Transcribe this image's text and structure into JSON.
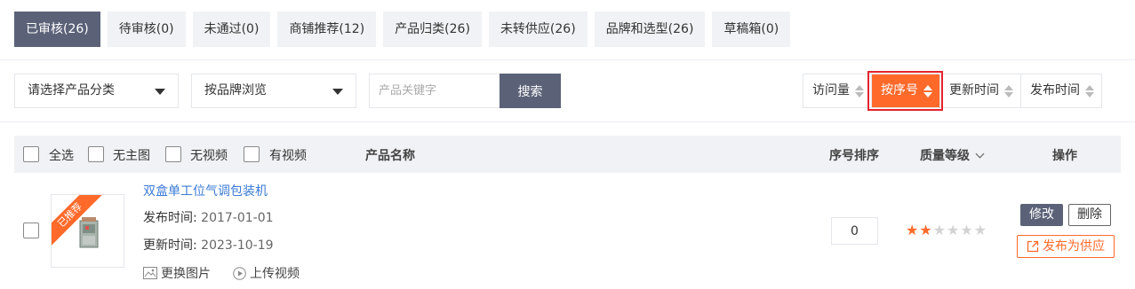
{
  "tabs": [
    {
      "label": "已审核(26)",
      "active": true
    },
    {
      "label": "待审核(0)",
      "active": false
    },
    {
      "label": "未通过(0)",
      "active": false
    },
    {
      "label": "商铺推荐(12)",
      "active": false
    },
    {
      "label": "产品归类(26)",
      "active": false
    },
    {
      "label": "未转供应(26)",
      "active": false
    },
    {
      "label": "品牌和选型(26)",
      "active": false
    },
    {
      "label": "草稿箱(0)",
      "active": false
    }
  ],
  "filters": {
    "category_select": "请选择产品分类",
    "brand_select": "按品牌浏览",
    "keyword_placeholder": "产品关键字",
    "search_label": "搜索"
  },
  "sorts": [
    {
      "label": "访问量",
      "active": false
    },
    {
      "label": "按序号",
      "active": true
    },
    {
      "label": "更新时间",
      "active": false
    },
    {
      "label": "发布时间",
      "active": false
    }
  ],
  "table": {
    "select_all": "全选",
    "no_main_image": "无主图",
    "no_video": "无视频",
    "has_video": "有视频",
    "col_name": "产品名称",
    "col_order": "序号排序",
    "col_quality": "质量等级",
    "col_actions": "操作"
  },
  "row": {
    "ribbon": "已推荐",
    "title": "双盒单工位气调包装机",
    "publish_label": "发布时间:",
    "publish_date": "2017-01-01",
    "update_label": "更新时间:",
    "update_date": "2023-10-19",
    "replace_image": "更换图片",
    "upload_video": "上传视频",
    "order_value": "0",
    "quality_stars": 2,
    "quality_max": 6,
    "edit": "修改",
    "delete": "删除",
    "publish_supply": "发布为供应"
  },
  "colors": {
    "primary": "#5b6278",
    "accent": "#ff6a2b",
    "link": "#3a7bd5",
    "highlight_border": "#e5232f"
  }
}
